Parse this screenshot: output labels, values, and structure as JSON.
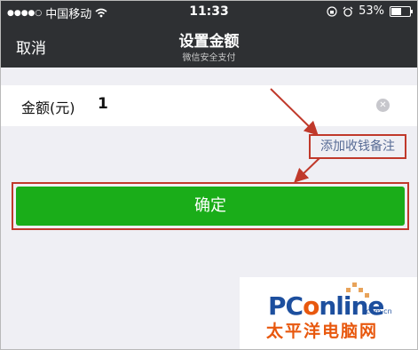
{
  "status_bar": {
    "carrier": "中国移动",
    "time": "11:33",
    "battery_text": "53%",
    "icons": [
      "signal-dots-icon",
      "wifi-icon",
      "orientation-lock-icon",
      "alarm-icon",
      "battery-icon"
    ]
  },
  "nav": {
    "cancel_label": "取消",
    "title": "设置金额",
    "subtitle": "微信安全支付"
  },
  "form": {
    "amount_label": "金额(元)",
    "amount_value": "1",
    "clear_icon": "clear-icon"
  },
  "note_link_label": "添加收钱备注",
  "confirm_label": "确定",
  "watermark": {
    "brand_prefix": "PC",
    "brand_o": "o",
    "brand_suffix": "nline",
    "domain": ".com.cn",
    "chinese_name": "太平洋电脑网"
  },
  "colors": {
    "nav_bg": "#2e3033",
    "confirm_green": "#1aad19",
    "link_blue": "#576b95",
    "annotation_red": "#c0392b"
  }
}
